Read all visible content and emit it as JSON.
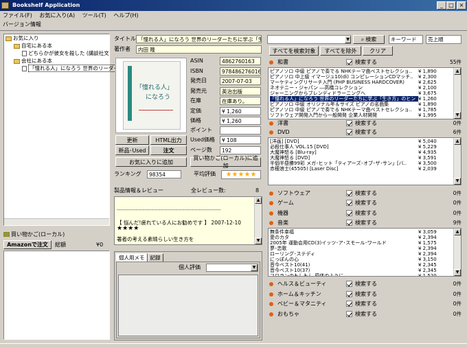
{
  "window": {
    "title": "Bookshelf Application",
    "min": "_",
    "max": "□",
    "close": "×"
  },
  "menu": [
    "ファイル(F)",
    "お気に入り(A)",
    "ツール(T)",
    "ヘルプ(H)"
  ],
  "toolbar": {
    "version_info": "バージョン情報"
  },
  "tree": {
    "root": "お気に入り",
    "n1": "自宅にある本",
    "n1a": "どちらかが彼女を殺した (講談社文",
    "n2": "会社にある本",
    "n2a": "「憧れる人」になろう 世界のリーダー"
  },
  "cart": {
    "title": "買い物かご(ローカル)",
    "order_btn": "Amazonで注文",
    "total_label": "総額",
    "total": "¥0"
  },
  "detail": {
    "title_label": "タイトル",
    "title": "「憧れる人」になろう 世界のリーダーたちに学ぶ「生き方」のヒン",
    "author_label": "著作者",
    "author": "内田 隆",
    "cover_title": "「憧れる人」",
    "cover_sub": "になろう",
    "asin_label": "ASIN",
    "asin": "4862760163",
    "isbn_label": "ISBN",
    "isbn": "9784862760166",
    "date_label": "発売日",
    "date": "2007-07-03",
    "publisher_label": "発売元",
    "publisher": "英治出版",
    "stock_label": "在庫",
    "stock": "在庫あり。",
    "list_price_label": "定価",
    "list_price": "¥ 1,260",
    "price_label": "価格",
    "price": "¥ 1,260",
    "point_label": "ポイント",
    "point": "",
    "used_label": "Used価格",
    "used_price": "¥ 108",
    "pages_label": "ページ数",
    "pages": "192",
    "rank_label": "ランキング",
    "rank": "98354",
    "avg_label": "平均評価",
    "avg_stars": "★★★★★",
    "btn_update": "更新",
    "btn_html": "HTML出力",
    "btn_new_used": "新品･Used",
    "btn_order": "注文",
    "btn_fav": "お気に入りに追加",
    "btn_cart": "買い物かご(ローカル)に追加"
  },
  "reviews": {
    "label": "製品情報＆レビュー",
    "count_label": "全レビュー数:",
    "count": "8",
    "dashes": "------------------------------------------------------------",
    "review_title": "【 悩んだ!疲れている人にお勧めです 】 2007-12-10",
    "review_stars": "★★★★",
    "review_body": "著者の考える素晴らしい生き方を"
  },
  "memo": {
    "tab1": "個人用メモ",
    "tab2": "記録",
    "rating_label": "個人評価"
  },
  "search": {
    "input": "",
    "search_btn": "検索",
    "mode": "キーワード",
    "sort": "売上順",
    "all_btn": "すべてを検索対象",
    "none_btn": "すべてを除外",
    "clear_btn": "クリア",
    "search_label": "検索する"
  },
  "categories": [
    {
      "name": "和書",
      "count": "55件",
      "checked": true
    },
    {
      "name": "洋書",
      "count": "0件",
      "checked": true
    },
    {
      "name": "DVD",
      "count": "6件",
      "checked": true
    },
    {
      "name": "ソフトウェア",
      "count": "0件",
      "checked": true
    },
    {
      "name": "ゲーム",
      "count": "0件",
      "checked": true
    },
    {
      "name": "機器",
      "count": "0件",
      "checked": true
    },
    {
      "name": "音楽",
      "count": "9件",
      "checked": true
    },
    {
      "name": "ヘルス＆ビューティ",
      "count": "0件",
      "checked": true
    },
    {
      "name": "ホーム＆キッチン",
      "count": "0件",
      "checked": true
    },
    {
      "name": "ベビー＆マタニティ",
      "count": "0件",
      "checked": true
    },
    {
      "name": "おもちゃ",
      "count": "0件",
      "checked": true
    }
  ],
  "books": [
    [
      "ピアノソロ 中級 ピアノで奏でる NHKテーマ曲ベストセレクショ..",
      "¥ 1,890"
    ],
    [
      "ピアノソロ 中上級 イマージュ10(di) コンピレーションCDマッチ..",
      "¥ 2,300"
    ],
    [
      "マーケティングリサーチ入門 (PHP BUSINESS HARDCOVER)",
      "¥ 2,625"
    ],
    [
      "ネオテニー・ジャパン ―高橋コレクション",
      "¥ 2,100"
    ],
    [
      "ジャーニングからブレンディドラーニングへ",
      "¥ 3,675"
    ],
    [
      "「憧れる人」になろう 世界のリーダーたちに学ぶ「生き方」のヒン",
      "¥ 1,260"
    ],
    [
      "ピアノソロ 中級 オリジナル年＆サイズ ピアノの名曲集",
      "¥ 1,890"
    ],
    [
      "ピアノソロ 中級 ピアノで奏でる NHKテーマ曲ベストセレクショ..",
      "¥ 1,785"
    ],
    [
      "ソフトウェア開発入門から一般開発 企業人材開発",
      "¥ 1,995"
    ]
  ],
  "dvds": [
    [
      "[洋画] [DVD]",
      "¥ 5,040"
    ],
    [
      "必殺仕事人 VOL.15 [DVD]",
      "¥ 5,229"
    ],
    [
      "大魔神怒る [Blu-ray]",
      "¥ 4,935"
    ],
    [
      "大魔神怒る [DVD]",
      "¥ 3,591"
    ],
    [
      "半個半昼勝99彩 メガ･ヒット「ティアーズ･オブ･ザ･サン」[バ..",
      "¥ 3,500"
    ],
    [
      "赤穂浪士(45505) [Laser Disc]",
      "¥ 2,039"
    ]
  ],
  "music": [
    [
      "無条件幸福",
      "¥ 3,059"
    ],
    [
      "愛のカタ",
      "¥ 2,394"
    ],
    [
      "2005年 運動会用CD(3)イッツ･ア･スモール･ワールド",
      "¥ 1,575"
    ],
    [
      "夢･恋歌",
      "¥ 2,394"
    ],
    [
      "ローリング･ステディ",
      "¥ 2,394"
    ],
    [
      "にっぽんの心",
      "¥ 3,150"
    ],
    [
      "音今ベスト10(41)",
      "¥ 2,345"
    ],
    [
      "音今ベスト10(37)",
      "¥ 2,345"
    ],
    [
      "フロランのもしもし 原体のように",
      "¥ 1,520"
    ]
  ]
}
